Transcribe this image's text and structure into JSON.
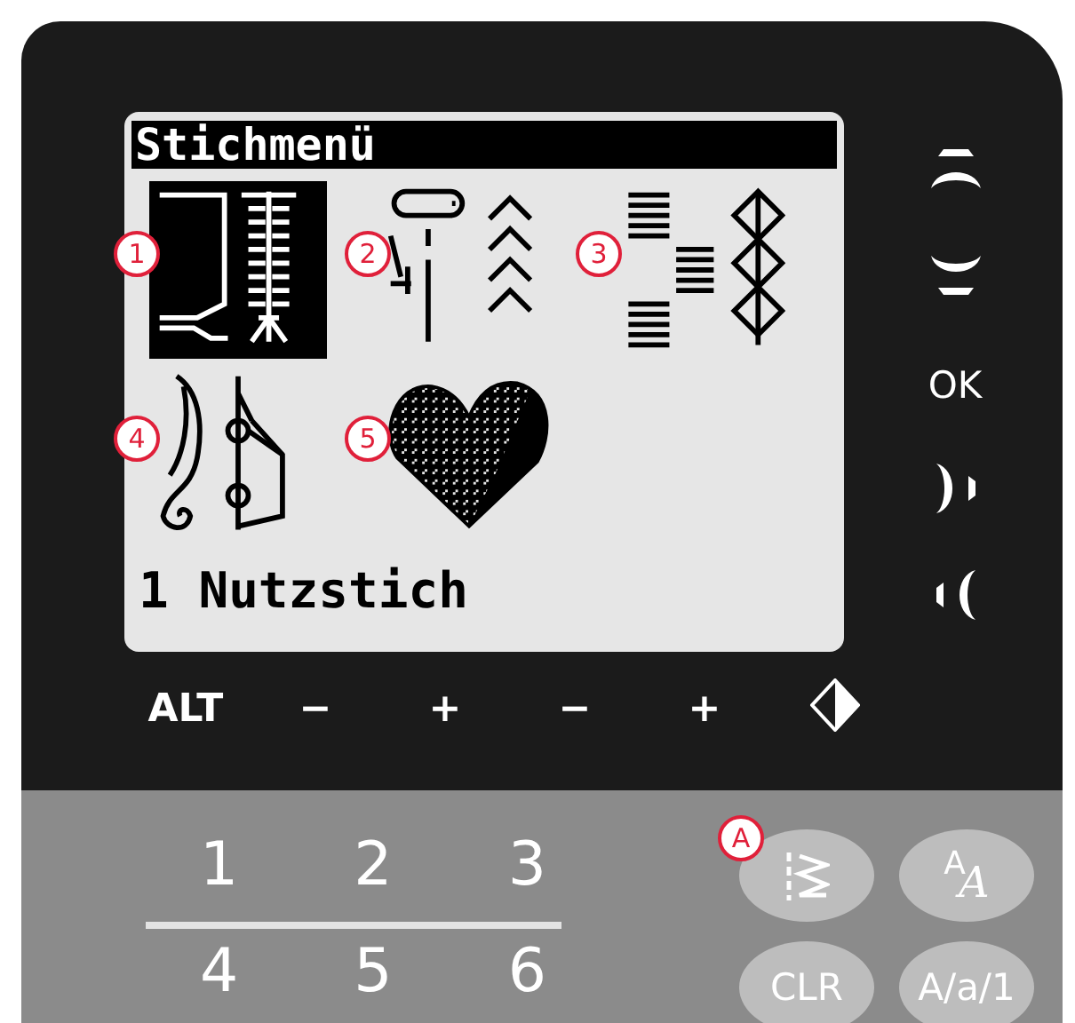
{
  "display": {
    "title": "Stichmenü",
    "categories": [
      {
        "selected": true,
        "callout": "1"
      },
      {
        "selected": false,
        "callout": "2"
      },
      {
        "selected": false,
        "callout": "3"
      },
      {
        "selected": false,
        "callout": "4"
      },
      {
        "selected": false,
        "callout": "5"
      }
    ],
    "status": "1 Nutzstich"
  },
  "side_keys": [
    {
      "kind": "up"
    },
    {
      "kind": "down"
    },
    {
      "kind": "text",
      "label": "OK"
    },
    {
      "kind": "right"
    },
    {
      "kind": "left"
    }
  ],
  "bottom_keys": [
    {
      "kind": "text",
      "label": "ALT"
    },
    {
      "kind": "text",
      "label": "−"
    },
    {
      "kind": "text",
      "label": "+"
    },
    {
      "kind": "text",
      "label": "−"
    },
    {
      "kind": "text",
      "label": "+"
    },
    {
      "kind": "mirror"
    }
  ],
  "number_keys": [
    [
      "1",
      "2",
      "3"
    ],
    [
      "4",
      "5",
      "6"
    ]
  ],
  "round_keys": [
    {
      "kind": "stitch",
      "callout": "A"
    },
    {
      "kind": "font",
      "letters": [
        "A",
        "A"
      ]
    },
    {
      "kind": "text",
      "label": "CLR"
    },
    {
      "kind": "text",
      "label": "A/a/1"
    }
  ]
}
